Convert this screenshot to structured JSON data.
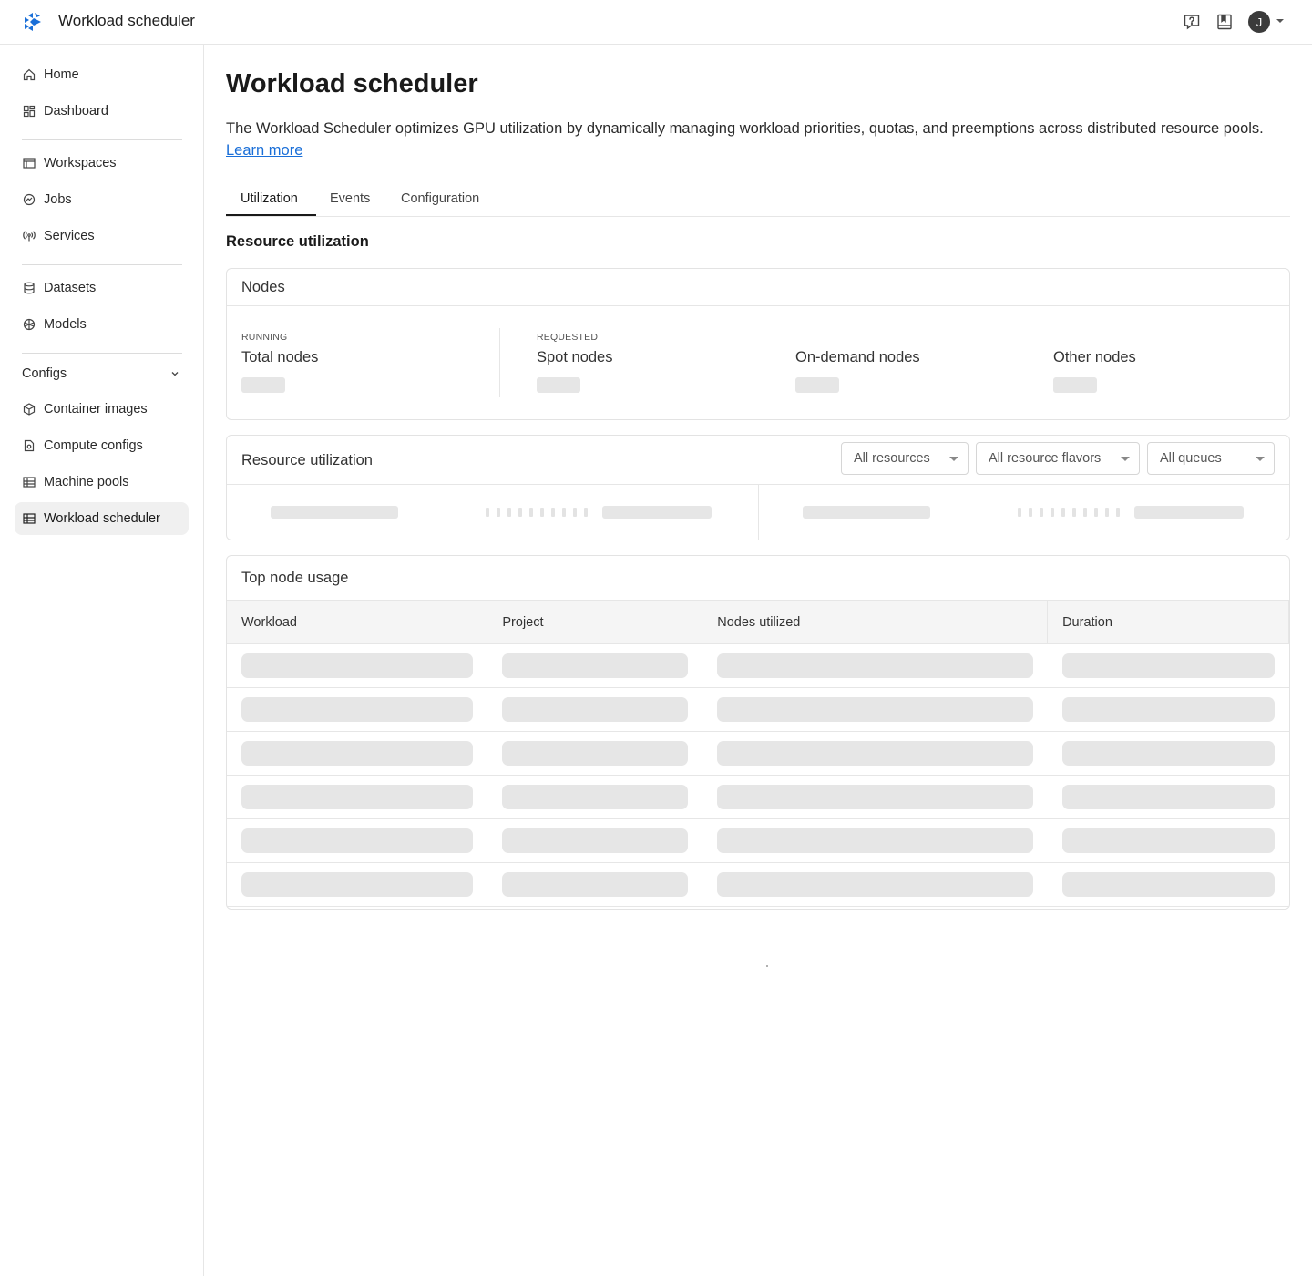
{
  "app": {
    "title": "Workload scheduler",
    "user_initial": "J"
  },
  "topbar": {
    "icons": [
      "help-icon",
      "docs-icon"
    ]
  },
  "sidebar": {
    "items_top": [
      {
        "label": "Home",
        "icon": "home-icon"
      },
      {
        "label": "Dashboard",
        "icon": "dashboard-icon"
      }
    ],
    "items_mid": [
      {
        "label": "Workspaces",
        "icon": "workspaces-icon"
      },
      {
        "label": "Jobs",
        "icon": "jobs-icon"
      },
      {
        "label": "Services",
        "icon": "services-icon"
      }
    ],
    "items_data": [
      {
        "label": "Datasets",
        "icon": "datasets-icon"
      },
      {
        "label": "Models",
        "icon": "models-icon"
      }
    ],
    "configs_header": "Configs",
    "items_configs": [
      {
        "label": "Container images",
        "icon": "container-icon"
      },
      {
        "label": "Compute configs",
        "icon": "compute-config-icon"
      },
      {
        "label": "Machine pools",
        "icon": "machine-pools-icon"
      },
      {
        "label": "Workload scheduler",
        "icon": "workload-scheduler-icon",
        "active": true
      }
    ]
  },
  "main": {
    "title": "Workload scheduler",
    "description": "The Workload Scheduler optimizes GPU utilization by dynamically managing workload priorities, quotas, and preemptions across distributed resource pools.",
    "learn_more": "Learn more",
    "tabs": [
      {
        "label": "Utilization",
        "active": true
      },
      {
        "label": "Events"
      },
      {
        "label": "Configuration"
      }
    ],
    "section_title": "Resource utilization",
    "nodes_card": {
      "title": "Nodes",
      "running_caption": "RUNNING",
      "requested_caption": "REQUESTED",
      "stats": [
        "Total nodes",
        "Spot nodes",
        "On-demand nodes",
        "Other nodes"
      ]
    },
    "utilization_card": {
      "title": "Resource utilization",
      "filters": [
        "All resources",
        "All resource flavors",
        "All queues"
      ]
    },
    "top_usage_card": {
      "title": "Top node usage",
      "columns": [
        "Workload",
        "Project",
        "Nodes utilized",
        "Duration"
      ],
      "row_count": 6
    }
  }
}
